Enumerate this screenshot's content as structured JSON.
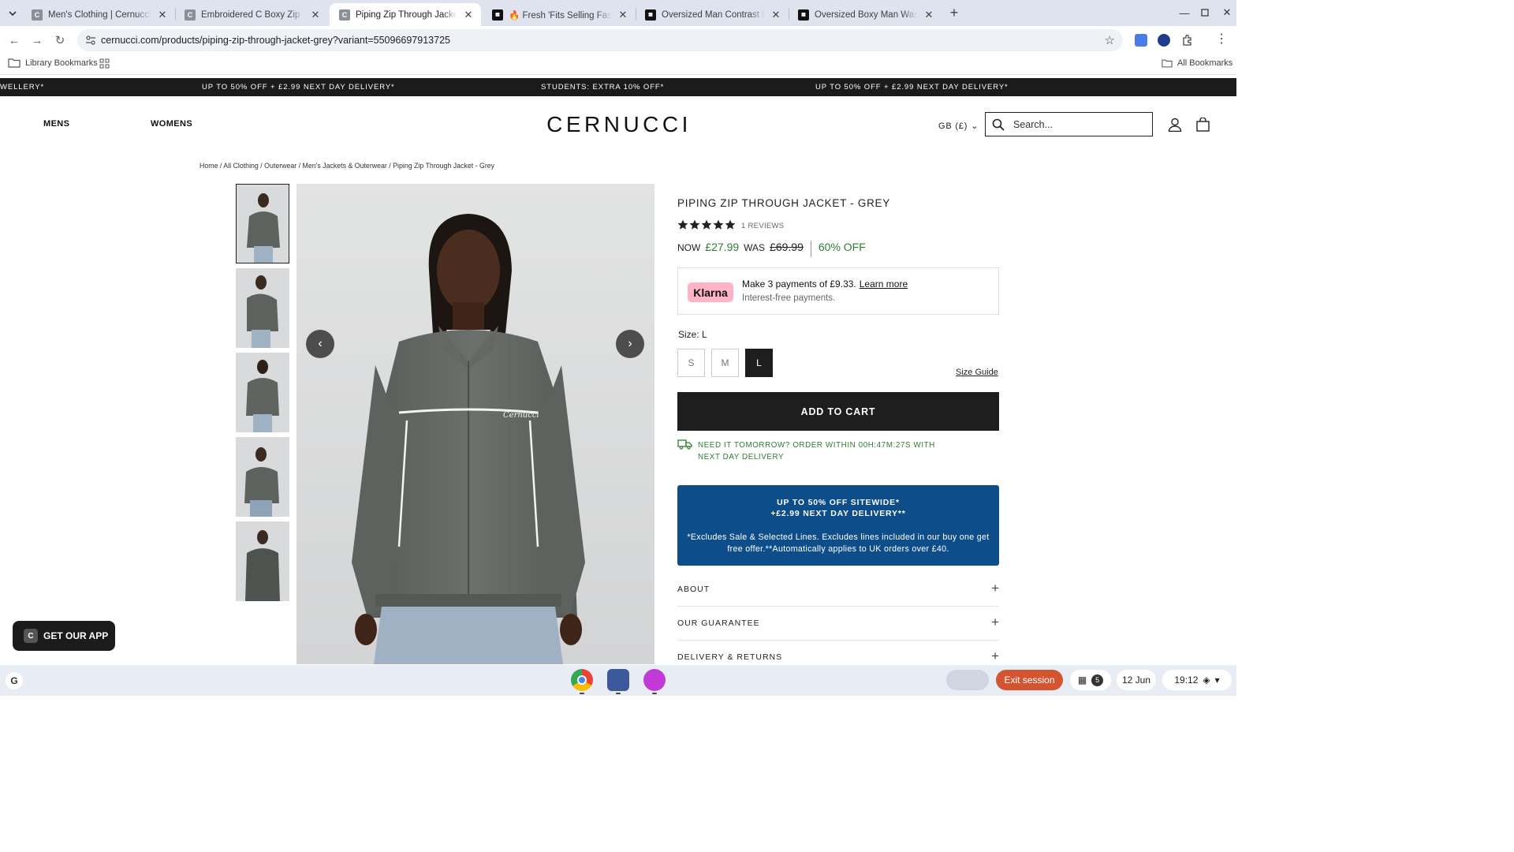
{
  "browser": {
    "tabs": [
      {
        "title": "Men's Clothing | Cernucci – Pa",
        "favicon": "C"
      },
      {
        "title": "Embroidered C Boxy Zip Throu",
        "favicon": "C"
      },
      {
        "title": "Piping Zip Through Jacket - Gr",
        "favicon": "C",
        "active": true
      },
      {
        "title": "🔥 Fresh 'Fits Selling Fast",
        "favicon": "dark"
      },
      {
        "title": "Oversized Man Contrast Embro",
        "favicon": "dark"
      },
      {
        "title": "Oversized Boxy Man Washed W",
        "favicon": "dark"
      }
    ],
    "url": "cernucci.com/products/piping-zip-through-jacket-grey?variant=55096697913725",
    "bookmarks": {
      "library": "Library Bookmarks",
      "all": "All Bookmarks"
    }
  },
  "promo": {
    "items": [
      "WELLERY*",
      "UP TO 50% OFF + £2.99 NEXT DAY DELIVERY*",
      "STUDENTS: EXTRA 10% OFF*",
      "UP TO 50% OFF + £2.99 NEXT DAY DELIVERY*"
    ]
  },
  "header": {
    "nav": [
      "MENS",
      "WOMENS"
    ],
    "logo": "CERNUCCI",
    "currency": "GB (£)",
    "search_placeholder": "Search..."
  },
  "breadcrumb": "Home / All Clothing / Outerwear / Men's Jackets & Outerwear / Piping Zip Through Jacket - Grey",
  "product": {
    "title": "PIPING ZIP THROUGH JACKET - GREY",
    "rating": 5,
    "reviews": "1 REVIEWS",
    "now_label": "NOW",
    "now_price": "£27.99",
    "was_label": "WAS",
    "was_price": "£69.99",
    "discount": "60% OFF",
    "klarna": {
      "badge": "Klarna",
      "line1": "Make 3 payments of £9.33.",
      "link": "Learn more",
      "line2": "Interest-free payments."
    },
    "size_label": "Size: L",
    "sizes": [
      "S",
      "M",
      "L"
    ],
    "selected_size": "L",
    "size_guide": "Size Guide",
    "add_to_cart": "ADD TO CART",
    "delivery_note": "NEED IT TOMORROW? ORDER WITHIN 00H:47M:27S WITH NEXT DAY DELIVERY",
    "promo_box": {
      "line1": "UP TO 50% OFF SITEWIDE*",
      "line2": "+£2.99 NEXT DAY DELIVERY**",
      "body": "*Excludes Sale & Selected Lines. Excludes lines included in our buy one get free offer.**Automatically applies to UK orders over £40."
    },
    "accordions": [
      "ABOUT",
      "OUR GUARANTEE",
      "DELIVERY & RETURNS"
    ]
  },
  "get_app": "GET OUR APP",
  "shelf": {
    "exit": "Exit session",
    "notifications": "5",
    "date": "12 Jun",
    "time": "19:12"
  },
  "colors": {
    "green": "#2e7d32",
    "promo_blue": "#0d4d8a",
    "klarna_pink": "#ffb3c7",
    "exit_orange": "#d35431"
  }
}
